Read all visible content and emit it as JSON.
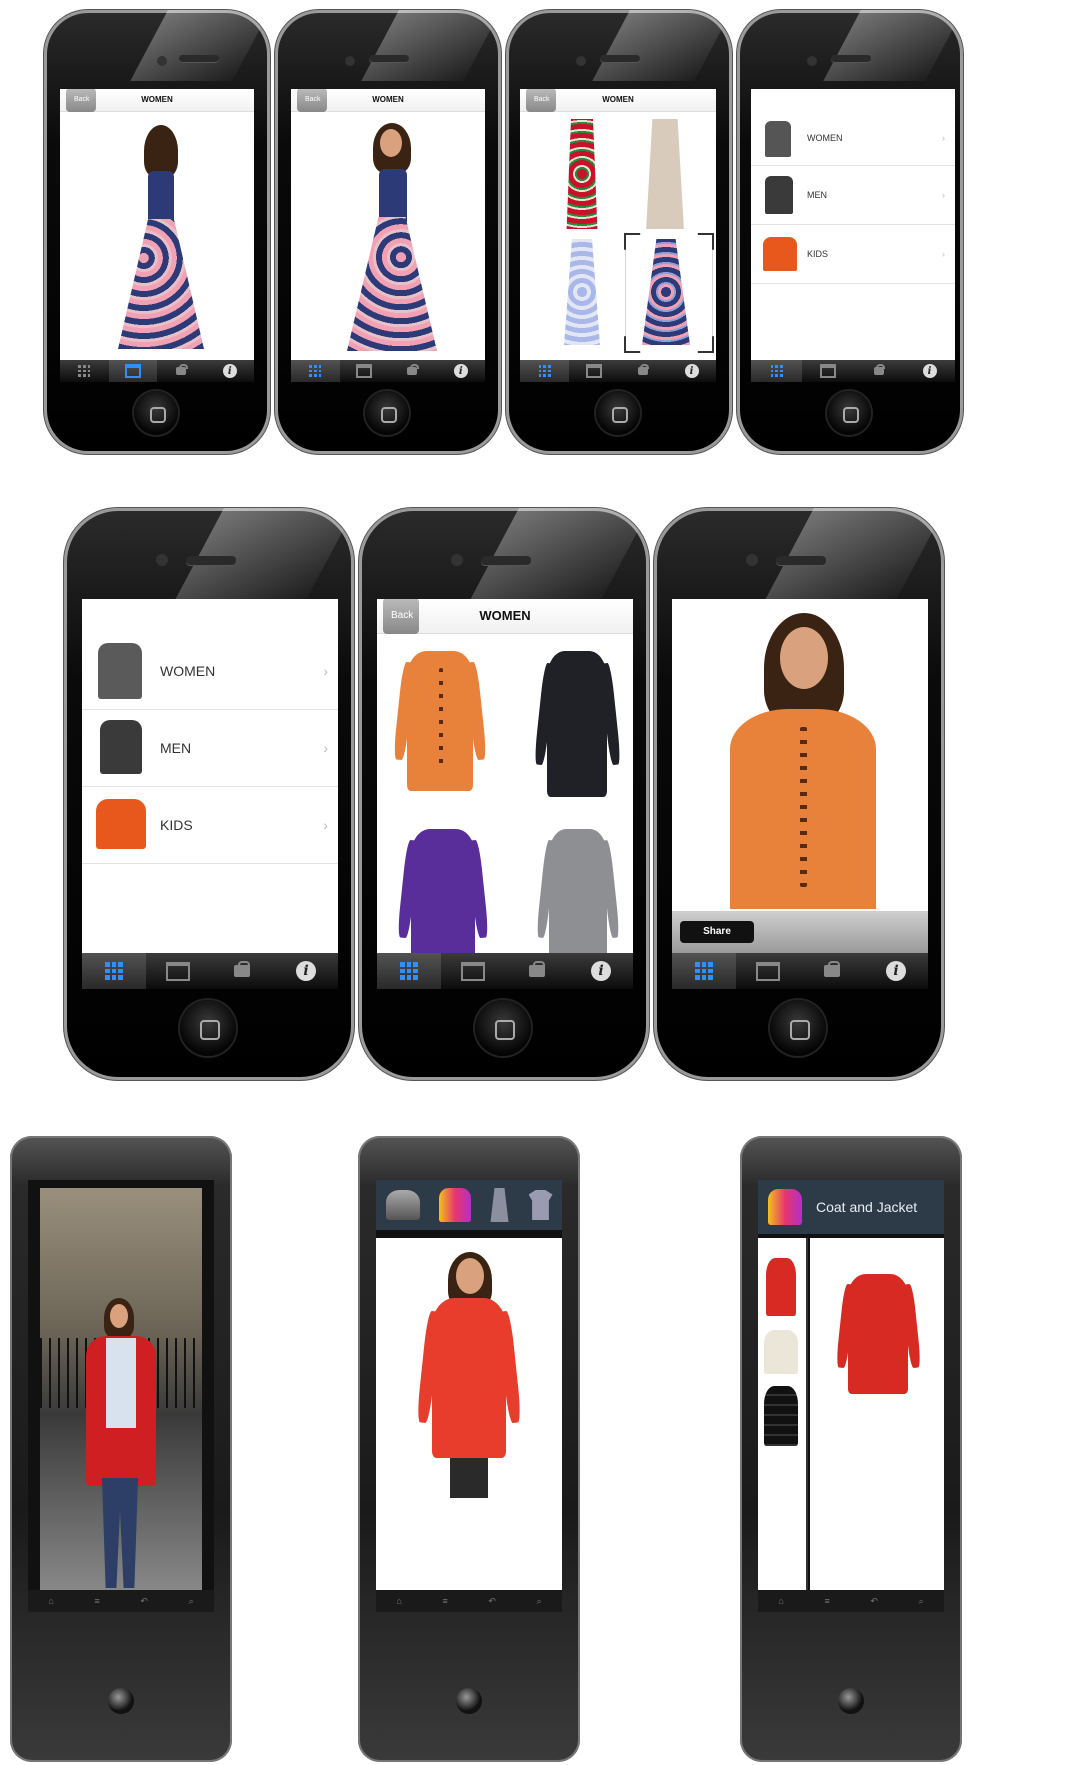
{
  "row1": [
    {
      "nav_title": "WOMEN",
      "back_label": "Back",
      "view": "back-view"
    },
    {
      "nav_title": "WOMEN",
      "back_label": "Back",
      "view": "front-view"
    },
    {
      "nav_title": "WOMEN",
      "back_label": "Back",
      "view": "dress-grid"
    },
    {
      "view": "categories"
    }
  ],
  "categories": [
    {
      "label": "WOMEN",
      "icon": "jacket-icon"
    },
    {
      "label": "MEN",
      "icon": "jacket-icon"
    },
    {
      "label": "KIDS",
      "icon": "coat-icon"
    }
  ],
  "row2": {
    "phone2": {
      "nav_title": "WOMEN",
      "back_label": "Back"
    },
    "phone3": {
      "share_label": "Share"
    }
  },
  "tabs": [
    "grid-icon",
    "calendar-icon",
    "bag-icon",
    "info-icon"
  ],
  "android3": {
    "category_title": "Coat and Jacket"
  },
  "colors": {
    "tab_active": "#2f8fff",
    "orange_coat": "#e8813a",
    "red_coat": "#d62a22",
    "dress_navy": "#2c3b78",
    "android_catbar": "#2d3a48"
  }
}
